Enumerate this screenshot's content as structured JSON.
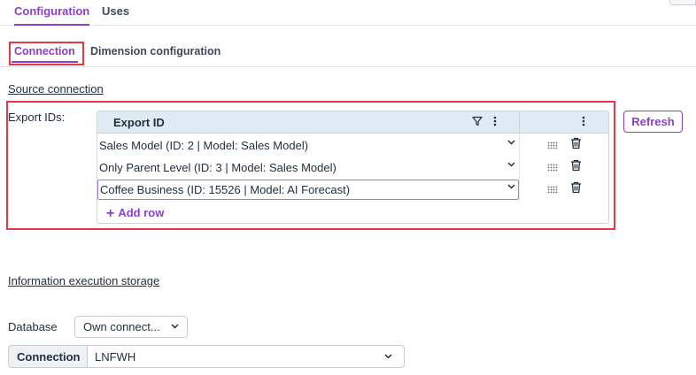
{
  "top_tabs": [
    {
      "label": "Configuration",
      "active": true
    },
    {
      "label": "Uses",
      "active": false
    }
  ],
  "sub_tabs": [
    {
      "label": "Connection",
      "active": true
    },
    {
      "label": "Dimension configuration",
      "active": false
    }
  ],
  "source_connection": {
    "heading": "Source connection",
    "export_ids_label": "Export IDs:",
    "grid": {
      "column_header": "Export ID",
      "rows": [
        {
          "value": "Sales Model (ID: 2 | Model: Sales Model)"
        },
        {
          "value": "Only Parent Level (ID: 3 | Model: Sales Model)"
        },
        {
          "value": "Coffee Business  (ID: 15526 | Model: AI Forecast)"
        }
      ],
      "add_row_label": "Add row"
    },
    "refresh_label": "Refresh"
  },
  "information_execution_storage": {
    "heading": "Information execution storage",
    "database_label": "Database",
    "database_value": "Own connect...",
    "connection_label": "Connection",
    "connection_value": "LNFWH"
  },
  "colors": {
    "accent": "#8a3fcf",
    "highlight": "#e53945",
    "grid_header_bg": "#deebf2"
  }
}
